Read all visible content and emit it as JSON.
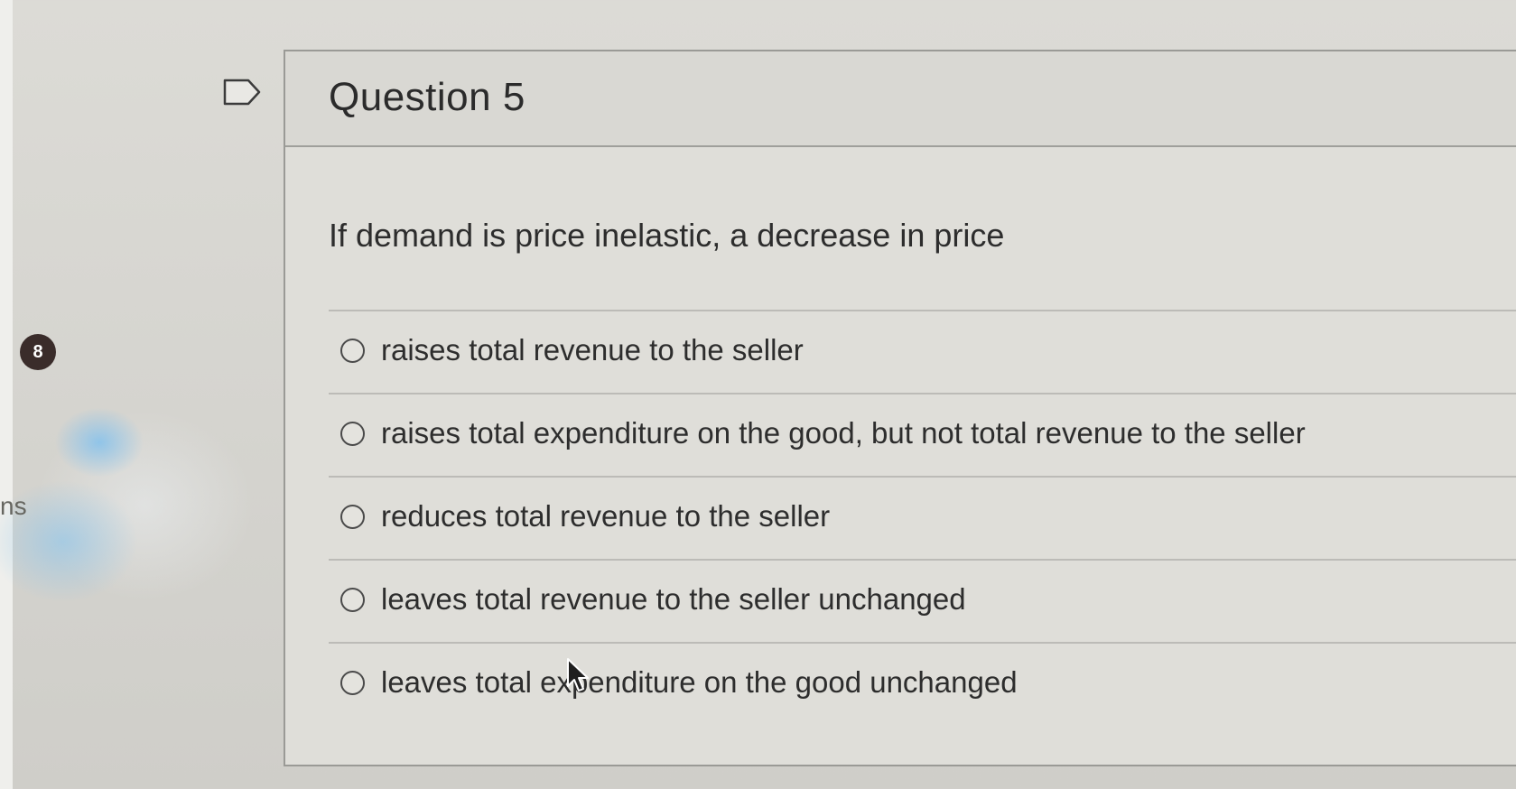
{
  "page": {
    "side_badge": "8",
    "side_text": "ns"
  },
  "question": {
    "title": "Question 5",
    "prompt": "If demand is price inelastic, a decrease in price",
    "answers": [
      "raises total revenue to the seller",
      "raises total expenditure on the good, but not total revenue to the seller",
      "reduces total revenue to the seller",
      "leaves total revenue to the seller unchanged",
      "leaves total expenditure on the good unchanged"
    ]
  },
  "icons": {
    "flag": "flag-icon",
    "cursor": "mouse-cursor-icon"
  },
  "colors": {
    "badge": "#3a2c2a",
    "text": "#2d2d2d",
    "border": "#9a9a96"
  }
}
